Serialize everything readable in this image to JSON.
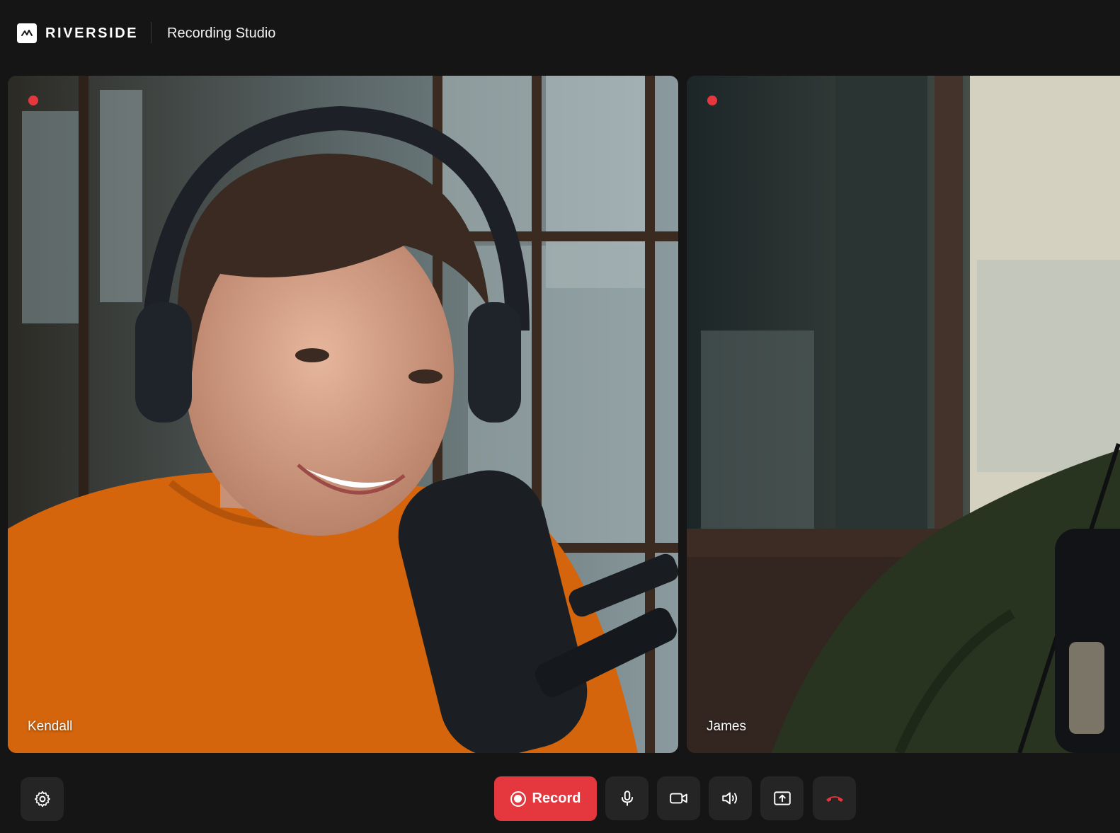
{
  "header": {
    "brand": "RIVERSIDE",
    "title": "Recording Studio"
  },
  "participants": [
    {
      "name": "Kendall",
      "recording": true
    },
    {
      "name": "James",
      "recording": true
    }
  ],
  "toolbar": {
    "record_label": "Record",
    "buttons": [
      "settings-icon",
      "microphone-icon",
      "camera-icon",
      "speaker-icon",
      "share-screen-icon",
      "hang-up-icon"
    ]
  },
  "colors": {
    "background": "#151515",
    "button": "#252525",
    "accent_red": "#e5383e"
  }
}
